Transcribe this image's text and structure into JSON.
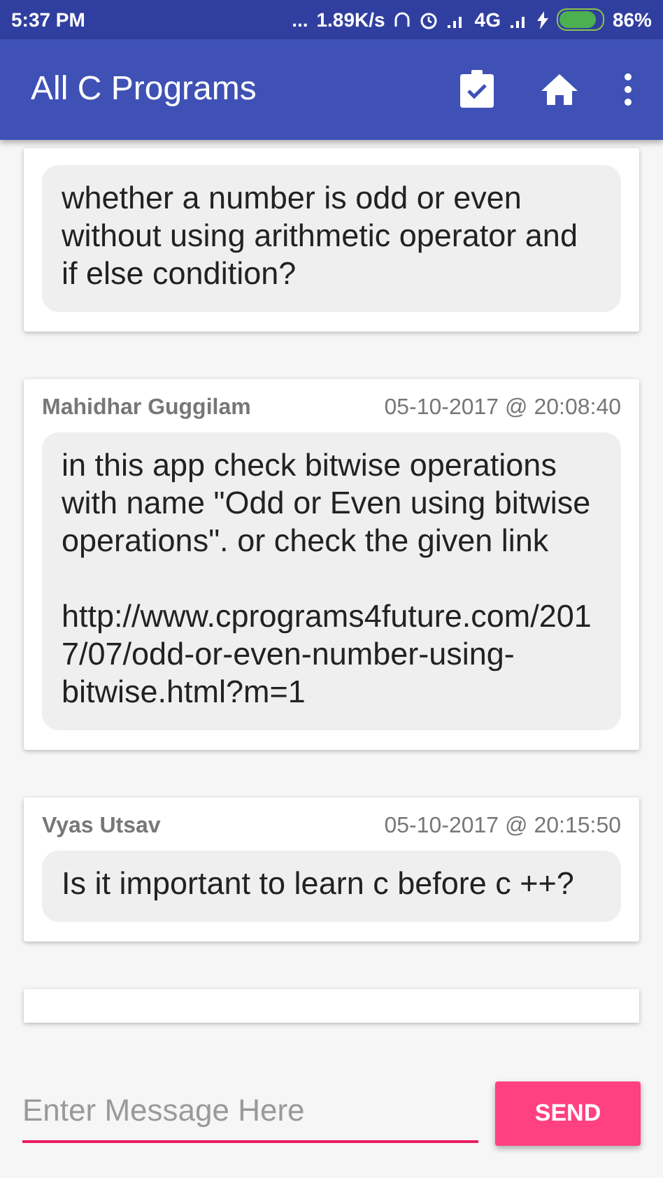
{
  "status_bar": {
    "time": "5:37 PM",
    "dots": "...",
    "speed": "1.89K/s",
    "network": "4G",
    "battery": "86%"
  },
  "app_bar": {
    "title": "All C Programs"
  },
  "messages": [
    {
      "text": "whether a number is odd or even without using arithmetic operator and if else condition?"
    },
    {
      "name": "Mahidhar Guggilam",
      "timestamp": "05-10-2017 @ 20:08:40",
      "text": "in this app check bitwise operations with name \"Odd or Even using bitwise operations\". or check the given link\n\nhttp://www.cprograms4future.com/2017/07/odd-or-even-number-using-bitwise.html?m=1"
    },
    {
      "name": "Vyas Utsav",
      "timestamp": "05-10-2017 @ 20:15:50",
      "text": "Is it important to learn c before c ++?"
    }
  ],
  "composer": {
    "placeholder": "Enter Message Here",
    "button": "SEND"
  }
}
